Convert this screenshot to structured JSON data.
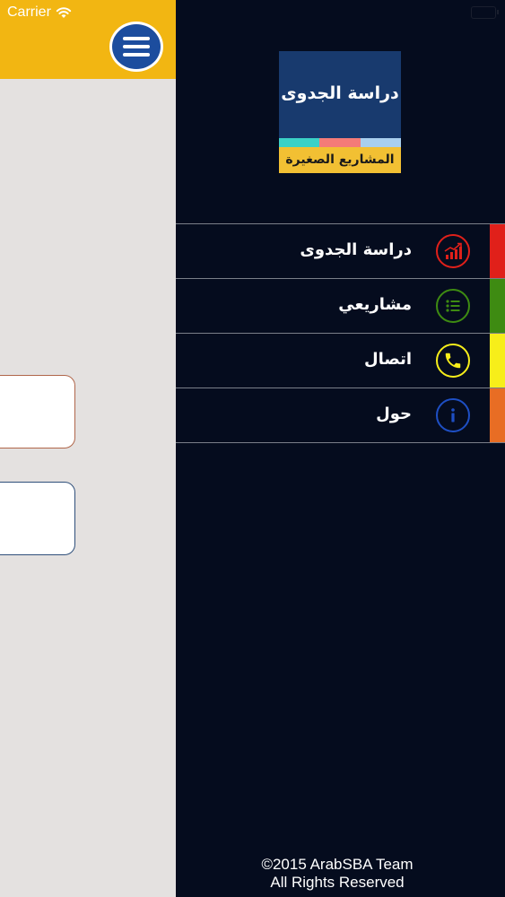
{
  "status_bar": {
    "carrier": "Carrier"
  },
  "drawer": {
    "logo": {
      "title": "دراسة الجدوى",
      "subtitle": "المشاريع الصغيرة",
      "stripe_colors": [
        "#3bd1c7",
        "#f47b78",
        "#a9cfee"
      ]
    },
    "menu_items": [
      {
        "label": "دراسة الجدوى",
        "icon": "bar-chart-icon",
        "color": "#e0201a"
      },
      {
        "label": "مشاريعي",
        "icon": "list-icon",
        "color": "#3e8b12"
      },
      {
        "label": "اتصال",
        "icon": "phone-icon",
        "color": "#f7ee1a"
      },
      {
        "label": "حول",
        "icon": "info-icon",
        "color": "#e86d24"
      }
    ],
    "footer": {
      "line1": "©2015 ArabSBA Team",
      "line2": "All Rights Reserved"
    }
  },
  "colors": {
    "header": "#f2b612",
    "menu_button": "#1c4d9e",
    "drawer_bg": "#050c1e",
    "main_bg": "#e4e1e0",
    "icon_blue": "#1e4fc4"
  }
}
